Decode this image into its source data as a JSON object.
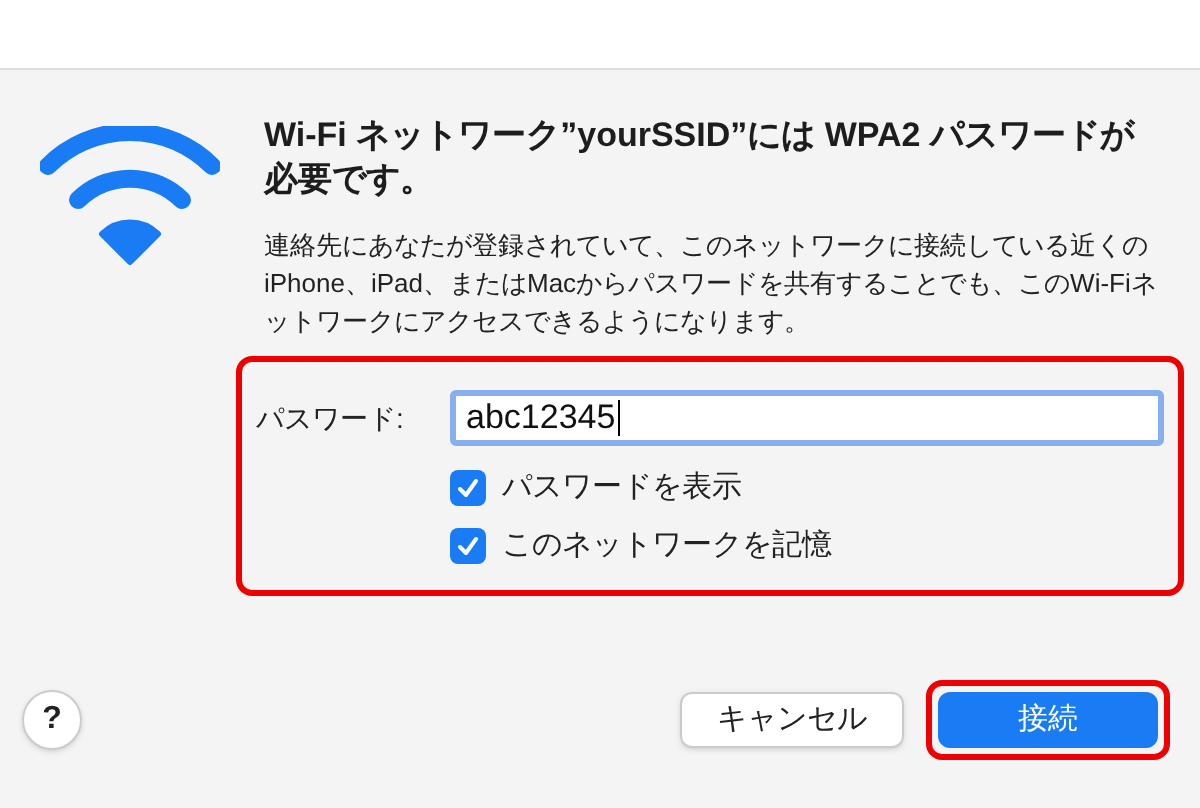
{
  "dialog": {
    "title": "Wi-Fi ネットワーク”yourSSID”には WPA2 パスワードが必要です。",
    "message": "連絡先にあなたが登録されていて、このネットワークに接続している近くのiPhone、iPad、またはMacからパスワードを共有することでも、このWi-Fiネットワークにアクセスできるようになります。",
    "form": {
      "highlighted": true,
      "password_label": "パスワード:",
      "password_value": "abc12345",
      "options": [
        {
          "label": "パスワードを表示",
          "checked": true
        },
        {
          "label": "このネットワークを記憶",
          "checked": true
        }
      ]
    },
    "help_button": "?",
    "buttons": [
      {
        "label": "キャンセル",
        "kind": "secondary",
        "highlighted": false
      },
      {
        "label": "接続",
        "kind": "primary",
        "highlighted": true
      }
    ]
  }
}
